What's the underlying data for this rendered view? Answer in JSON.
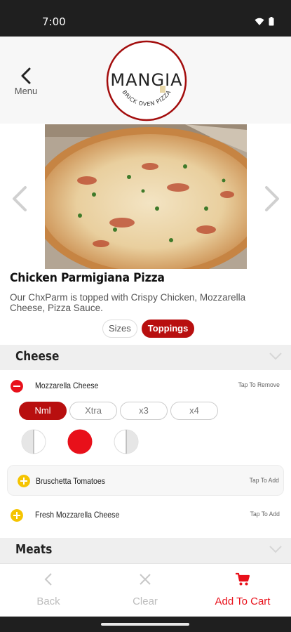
{
  "status_bar": {
    "time": "7:00"
  },
  "header": {
    "back_label": "Menu",
    "logo_text": "MANGIA",
    "logo_subtext": "BRICK OVEN PIZZA"
  },
  "product": {
    "title": "Chicken Parmigiana Pizza",
    "description": "Our ChxParm is topped with Crispy Chicken, Mozzarella Cheese, Pizza Sauce."
  },
  "tabs": [
    {
      "label": "Sizes",
      "active": false
    },
    {
      "label": "Toppings",
      "active": true
    }
  ],
  "sections": [
    {
      "title": "Cheese"
    },
    {
      "title": "Meats"
    }
  ],
  "toppings": [
    {
      "name": "Mozzarella Cheese",
      "action": "Tap To Remove",
      "selected": true
    },
    {
      "name": "Bruschetta Tomatoes",
      "action": "Tap To Add",
      "selected": false
    },
    {
      "name": "Fresh Mozzarella Cheese",
      "action": "Tap To Add",
      "selected": false
    }
  ],
  "quantity_options": [
    {
      "label": "Nml",
      "active": true
    },
    {
      "label": "Xtra",
      "active": false
    },
    {
      "label": "x3",
      "active": false
    },
    {
      "label": "x4",
      "active": false
    }
  ],
  "portion_options": [
    "left-half",
    "whole",
    "right-half"
  ],
  "bottom_bar": {
    "back_label": "Back",
    "clear_label": "Clear",
    "add_to_cart_label": "Add To Cart"
  },
  "colors": {
    "brand_red": "#b80f0f",
    "add_yellow": "#f5c400",
    "remove_red": "#e8101a",
    "disabled_gray": "#bdbdbd"
  }
}
